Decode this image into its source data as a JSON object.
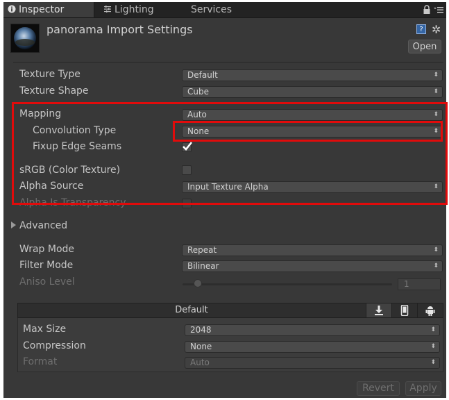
{
  "tabs": [
    {
      "label": "Inspector",
      "icon": "info-icon",
      "active": true
    },
    {
      "label": "Lighting",
      "icon": "lighting-icon",
      "active": false
    },
    {
      "label": "Services",
      "icon": "",
      "active": false
    }
  ],
  "header": {
    "title": "panorama Import Settings",
    "open_label": "Open"
  },
  "settings": {
    "texture_type": {
      "label": "Texture Type",
      "value": "Default"
    },
    "texture_shape": {
      "label": "Texture Shape",
      "value": "Cube"
    },
    "mapping": {
      "label": "Mapping",
      "value": "Auto"
    },
    "convolution_type": {
      "label": "Convolution Type",
      "value": "None"
    },
    "fixup_edge_seams": {
      "label": "Fixup Edge Seams",
      "checked": true
    },
    "srgb": {
      "label": "sRGB (Color Texture)",
      "checked": false
    },
    "alpha_source": {
      "label": "Alpha Source",
      "value": "Input Texture Alpha"
    },
    "alpha_is_transparency": {
      "label": "Alpha Is Transparency",
      "checked": false,
      "disabled": true
    }
  },
  "advanced": {
    "label": "Advanced",
    "expanded": false
  },
  "sampling": {
    "wrap_mode": {
      "label": "Wrap Mode",
      "value": "Repeat"
    },
    "filter_mode": {
      "label": "Filter Mode",
      "value": "Bilinear"
    },
    "aniso_level": {
      "label": "Aniso Level",
      "value": "1",
      "disabled": true
    }
  },
  "platform": {
    "tab_label": "Default",
    "tabs": [
      {
        "icon": "download-icon",
        "active": true
      },
      {
        "icon": "mobile-icon",
        "active": false
      },
      {
        "icon": "android-icon",
        "active": false
      }
    ],
    "max_size": {
      "label": "Max Size",
      "value": "2048"
    },
    "compression": {
      "label": "Compression",
      "value": "None"
    },
    "format": {
      "label": "Format",
      "value": "Auto",
      "disabled": true
    }
  },
  "footer": {
    "revert_label": "Revert",
    "apply_label": "Apply"
  },
  "colors": {
    "panel_bg": "#383838",
    "tab_bg": "#232323",
    "highlight_red": "#e10b0b"
  }
}
